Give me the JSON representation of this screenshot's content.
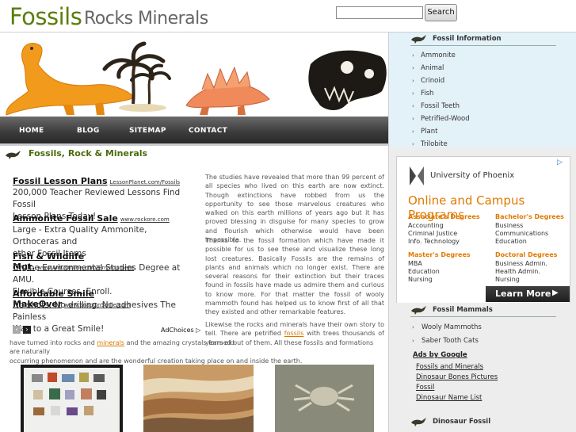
{
  "header": {
    "logo_primary": "Fossils",
    "logo_secondary": "Rocks Minerals",
    "search_placeholder": "",
    "search_button": "Search"
  },
  "nav": {
    "items": [
      "HOME",
      "BLOG",
      "SITEMAP",
      "CONTACT"
    ]
  },
  "main": {
    "title": "Fossils, Rock & Minerals",
    "ads": [
      {
        "title": "Fossil Lesson Plans",
        "url": "LessonPlanet.com/Fossils",
        "desc": [
          "200,000 Teacher Reviewed Lessons Find Fossil",
          "Lesson Plans Today!"
        ]
      },
      {
        "title": "Ammonite Fossil Sale",
        "url": "www.rockore.com",
        "desc": [
          "Large - Extra Quality Ammonite, Orthoceras and",
          "other Fossil Items"
        ]
      },
      {
        "title": "Fish & Wildlife Mgt.",
        "url": "www.AMUOnline.com/Environment",
        "desc": [
          "Online Environmental Studies Degree at AMU.",
          "Flexible Courses. Enroll."
        ]
      },
      {
        "title": "Affordable Smile MakeOver",
        "url": "www.SnapOnSmile.com",
        "desc": [
          "No shots. No drilling. No adhesives The Painless",
          "Way to a Great Smile!"
        ]
      }
    ],
    "adchoices": "AdChoices",
    "para1": "The studies have revealed that more than 99 percent of all species who lived on this earth are now extinct. Though extinctions have robbed from us the opportunity to see those marvelous creatures who walked on this earth millions of years ago but it has proved blessing in disguise for many species to grow and flourish which otherwise would have been impossible.",
    "para2": "Thanks to the fossil formation which have made it possible for us to see these and visualize these long lost creatures. Basically Fossils are the remains of plants and animals which no longer exist. There are several reasons for their extinction but their traces found in fossils have made us admire them and curious to know more.  For that matter the fossil of wooly mammoth found has helped us to know first of all that they existed and other remarkable features.",
    "para3_a": "Likewise the rocks and minerals have their own story to tell. There are petrified ",
    "para3_link1": "fossils",
    "para3_b": " with trees thousands of years old",
    "para3_c": "have turned into rocks and ",
    "para3_link2": "minerals",
    "para3_d": " and the amazing crystals formed out of them. All these fossils and formations are naturally",
    "para3_e": "occurring phenomenon and are the wonderful creation taking place on and inside the earth."
  },
  "sidebar": {
    "info_title": "Fossil Information",
    "info_items": [
      "Ammonite",
      "Animal",
      "Crinoid",
      "Fish",
      "Fossil Teeth",
      "Petrified-Wood",
      "Plant",
      "Trilobite"
    ],
    "phx": {
      "brand": "University of Phoenix",
      "headline": "Online and Campus Programs",
      "assoc_title": "Associate's Degrees",
      "assoc_items": [
        "Accounting",
        "Criminal Justice",
        "Info. Technology"
      ],
      "bach_title": "Bachelor's Degrees",
      "bach_items": [
        "Business",
        "Communications",
        "Education"
      ],
      "master_title": "Master's Degrees",
      "master_items": [
        "MBA",
        "Education",
        "Nursing"
      ],
      "doc_title": "Doctoral Degrees",
      "doc_items": [
        "Business Admin.",
        "Health Admin.",
        "Nursing"
      ],
      "cta": "Learn More"
    },
    "mammals_title": "Fossil Mammals",
    "mammals_items": [
      "Wooly Mammoths",
      "Saber Tooth Cats"
    ],
    "ads_by": "Ads by Google",
    "ad_links": [
      "Fossils and Minerals",
      "Dinosaur Bones Pictures",
      "Fossil",
      "Dinosaur Name List"
    ],
    "dino_title": "Dinosaur Fossil"
  },
  "colors": {
    "logo_green": "#5a7e0c",
    "link_orange": "#d67a00",
    "phx_orange": "#e07a00",
    "sidebar_blue": "#e3f1f8"
  }
}
